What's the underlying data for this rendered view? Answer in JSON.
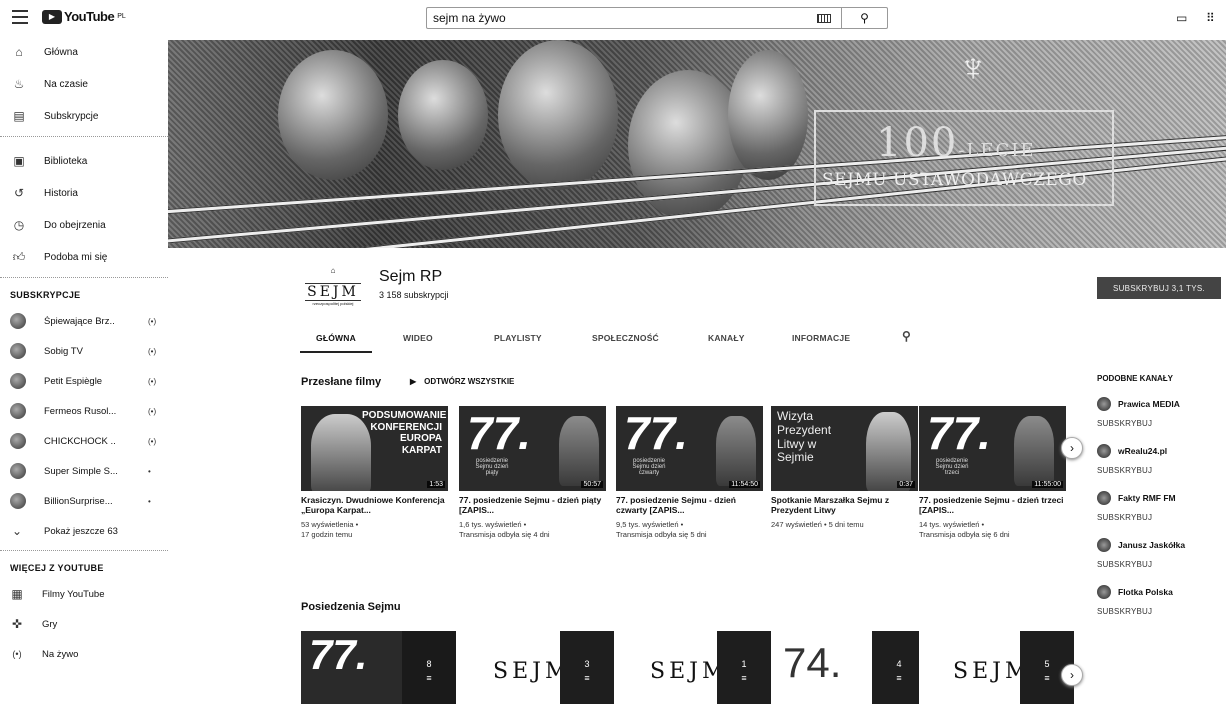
{
  "header": {
    "logo_text": "YouTube",
    "logo_region": "PL",
    "search_value": "sejm na żywo",
    "search_placeholder": "Szukaj"
  },
  "sidebar": {
    "main": [
      "Główna",
      "Na czasie",
      "Subskrypcje"
    ],
    "library": [
      "Biblioteka",
      "Historia",
      "Do obejrzenia",
      "Podoba mi się"
    ],
    "subs_title": "SUBSKRYPCJE",
    "subscriptions": [
      {
        "name": "Śpiewające Brz..",
        "badge": "(•)"
      },
      {
        "name": "Sobig TV",
        "badge": "(•)"
      },
      {
        "name": "Petit Espiègle",
        "badge": "(•)"
      },
      {
        "name": "Fermeos Rusol...",
        "badge": "(•)"
      },
      {
        "name": "CHICKCHOCK ..",
        "badge": "(•)"
      },
      {
        "name": "Super Simple S...",
        "badge": "•"
      },
      {
        "name": "BillionSurprise...",
        "badge": "•"
      }
    ],
    "show_more": "Pokaż jeszcze 63",
    "more_title": "WIĘCEJ Z YOUTUBE",
    "more_items": [
      "Filmy YouTube",
      "Gry",
      "Na żywo"
    ]
  },
  "banner": {
    "big": "100",
    "suffix": "-LECIE",
    "sub": "SEJMU USTAWODAWCZEGO"
  },
  "channel": {
    "logo_word": "SEJM",
    "logo_caption": "rzeczpospolitej polskiej",
    "name": "Sejm RP",
    "subscribers": "3 158 subskrypcji",
    "subscribe_label": "SUBSKRYBUJ 3,1 TYS."
  },
  "tabs": [
    "GŁÓWNA",
    "WIDEO",
    "PLAYLISTY",
    "SPOŁECZNOŚĆ",
    "KANAŁY",
    "INFORMACJE"
  ],
  "uploads": {
    "title": "Przesłane filmy",
    "play_all": "ODTWÓRZ WSZYSTKIE",
    "videos": [
      {
        "thumb_text": "PODSUMOWANIE KONFERENCJI EUROPA KARPAT",
        "duration": "1:53",
        "title": "Krasiczyn. Dwudniowe Konferencja „Europa Karpat...",
        "views": "53 wyświetlenia •",
        "time": "17 godzin temu"
      },
      {
        "thumb_big": "77.",
        "thumb_small": "posiedzenie Sejmu dzień piąty",
        "duration": "50:57",
        "title": "77. posiedzenie Sejmu - dzień piąty [ZAPIS...",
        "views": "1,6 tys. wyświetleń •",
        "time": "Transmisja odbyła się 4 dni"
      },
      {
        "thumb_big": "77.",
        "thumb_small": "posiedzenie Sejmu dzień czwarty",
        "duration": "11:54:50",
        "title": "77. posiedzenie Sejmu - dzień czwarty [ZAPIS...",
        "views": "9,5 tys. wyświetleń •",
        "time": "Transmisja odbyła się 5 dni"
      },
      {
        "thumb_text": "Wizyta Prezydent Litwy w Sejmie",
        "duration": "0:37",
        "title": "Spotkanie Marszałka Sejmu z Prezydent Litwy",
        "views": "247 wyświetleń • 5 dni temu",
        "time": ""
      },
      {
        "thumb_big": "77.",
        "thumb_small": "posiedzenie Sejmu dzień trzeci",
        "duration": "11:55:00",
        "title": "77. posiedzenie Sejmu - dzień trzeci [ZAPIS...",
        "views": "14 tys. wyświetleń •",
        "time": "Transmisja odbyła się 6 dni"
      }
    ]
  },
  "playlists": {
    "title": "Posiedzenia Sejmu",
    "items": [
      {
        "thumb": "77.",
        "count": "8"
      },
      {
        "thumb": "SEJM",
        "count": "3"
      },
      {
        "thumb": "SEJM",
        "count": "1"
      },
      {
        "thumb": "74.",
        "count": "4"
      },
      {
        "thumb": "SEJM",
        "count": "5"
      }
    ]
  },
  "related": {
    "title": "PODOBNE KANAŁY",
    "items": [
      {
        "name": "Prawica MEDIA",
        "action": "SUBSKRYBUJ"
      },
      {
        "name": "wRealu24.pl",
        "action": "SUBSKRYBUJ"
      },
      {
        "name": "Fakty RMF FM",
        "action": "SUBSKRYBUJ"
      },
      {
        "name": "Janusz Jaskółka",
        "action": "SUBSKRYBUJ"
      },
      {
        "name": "Flotka Polska",
        "action": "SUBSKRYBUJ"
      }
    ]
  }
}
